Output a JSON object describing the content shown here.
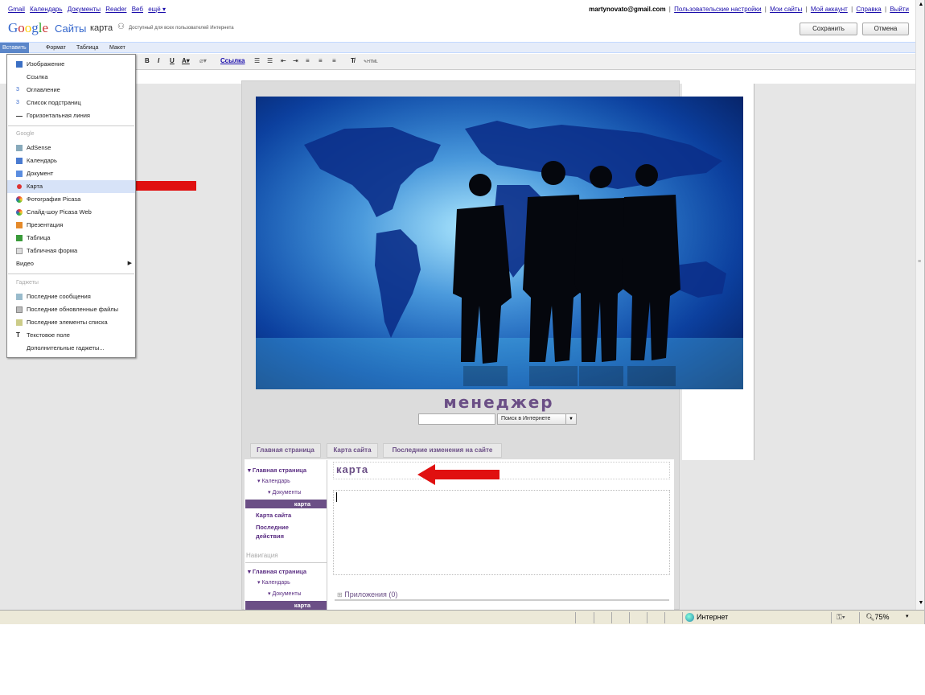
{
  "gbar": {
    "links": [
      "Gmail",
      "Календарь",
      "Документы",
      "Reader",
      "Веб",
      "ещё ▾"
    ],
    "email": "martynovato@gmail.com",
    "right_links": [
      "Пользовательские настройки",
      "Мои сайты",
      "Мой аккаунт",
      "Справка",
      "Выйти"
    ]
  },
  "header": {
    "product": "Сайты",
    "site_name": "карта",
    "share_status": "Доступный для всех пользователей Интернета",
    "save_label": "Сохранить",
    "cancel_label": "Отмена"
  },
  "menubar": [
    "Вставить",
    "Формат",
    "Таблица",
    "Макет"
  ],
  "toolbar": {
    "bold": "B",
    "italic": "I",
    "underline": "U",
    "link": "Ссылка",
    "html": "HTML"
  },
  "insert_menu": {
    "items_top": [
      "Изображение",
      "Ссылка",
      "Оглавление",
      "Список подстраниц",
      "Горизонтальная линия"
    ],
    "google_heading": "Google",
    "items_google": [
      "AdSense",
      "Календарь",
      "Документ",
      "Карта",
      "Фотография Picasa",
      "Слайд-шоу Picasa Web",
      "Презентация",
      "Таблица",
      "Табличная форма",
      "Видео"
    ],
    "gadgets_heading": "Гаджеты",
    "items_gadgets": [
      "Последние сообщения",
      "Последние обновленные файлы",
      "Последние элементы списка",
      "Текстовое поле",
      "Дополнительные гаджеты..."
    ],
    "highlighted": "Карта"
  },
  "site": {
    "title": "менеджер",
    "search_button": "Поиск в Интернете",
    "nav_tabs": [
      "Главная страница",
      "Карта сайта",
      "Последние изменения на сайте"
    ],
    "sidebar": {
      "home": "Главная страница",
      "calendar": "Календарь",
      "documents": "Документы",
      "current": "карта",
      "sitemap": "Карта сайта",
      "recent": "Последние действия",
      "nav_heading": "Навигация",
      "home2": "Главная страница",
      "calendar2": "Календарь",
      "documents2": "Документы",
      "current2": "карта"
    },
    "page_title": "карта",
    "attachments": "Приложения (0)"
  },
  "statusbar": {
    "zone": "Интернет",
    "zoom": "75%"
  },
  "colors": {
    "accent_purple": "#6b4f86",
    "arrow_red": "#e01010",
    "menu_highlight": "#d7e3f8"
  }
}
